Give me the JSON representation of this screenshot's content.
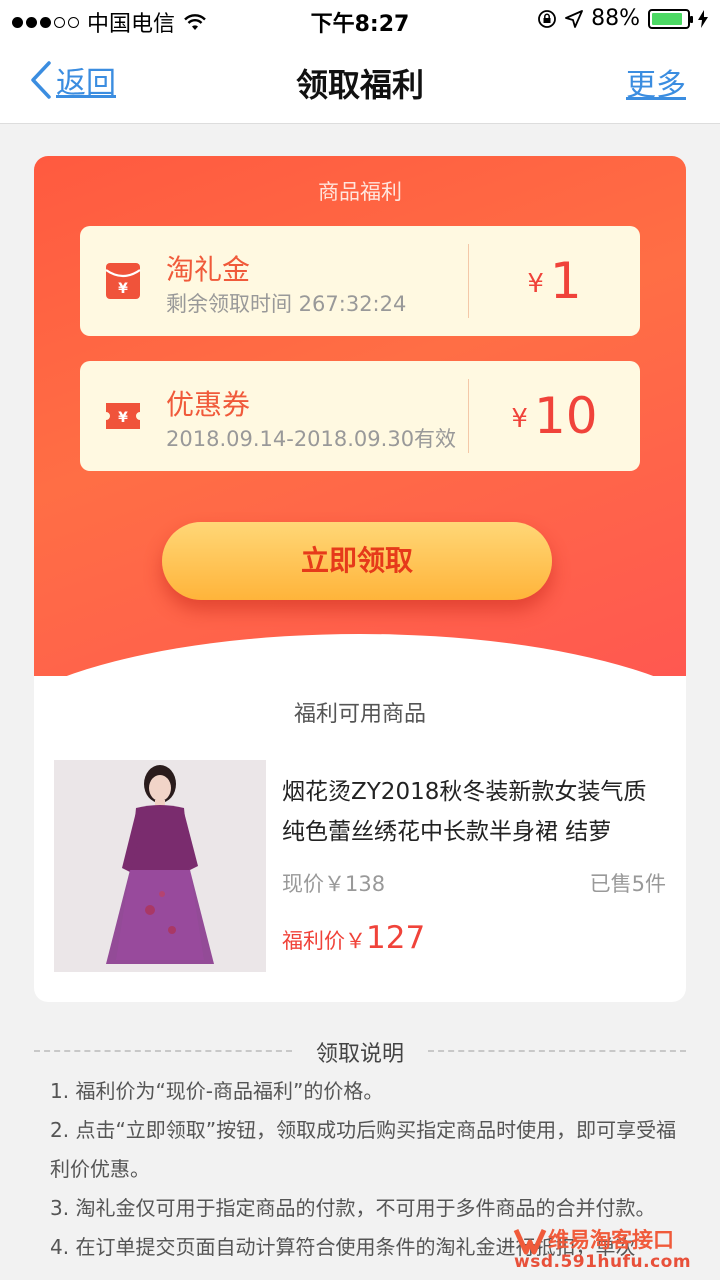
{
  "status_bar": {
    "carrier": "中国电信",
    "time": "下午8:27",
    "battery": "88%",
    "battery_level": 0.88
  },
  "nav": {
    "back_label": "返回",
    "title": "领取福利",
    "more_label": "更多"
  },
  "welfare": {
    "section_label": "商品福利",
    "items": [
      {
        "name": "淘礼金",
        "detail": "剩余领取时间 267:32:24",
        "currency": "¥",
        "amount": "1",
        "icon": "red-envelope-icon"
      },
      {
        "name": "优惠券",
        "detail": "2018.09.14-2018.09.30有效",
        "currency": "¥",
        "amount": "10",
        "icon": "coupon-ticket-icon"
      }
    ],
    "claim_button": "立即领取"
  },
  "available": {
    "title": "福利可用商品",
    "product": {
      "title": "烟花烫ZY2018秋冬装新款女装气质纯色蕾丝绣花中长款半身裙 结萝",
      "current_price": "现价￥138",
      "sold": "已售5件",
      "welfare_price_label": "福利价￥",
      "welfare_price": "127"
    }
  },
  "instructions": {
    "title": "领取说明",
    "lines": [
      "1. 福利价为“现价-商品福利”的价格。",
      "2. 点击“立即领取”按钮，领取成功后购买指定商品时使用，即可享受福利价优惠。",
      "3. 淘礼金仅可用于指定商品的付款，不可用于多件商品的合并付款。",
      "4. 在订单提交页面自动计算符合使用条件的淘礼金进行抵扣，单次"
    ]
  },
  "watermark": {
    "name": "维易淘客接口",
    "url": "wsd.591hufu.com"
  },
  "colors": {
    "accent_blue": "#3b8de0",
    "brand_red": "#f0433a",
    "gradient_start": "#ff5a40",
    "button_yellow": "#ffc04a"
  }
}
